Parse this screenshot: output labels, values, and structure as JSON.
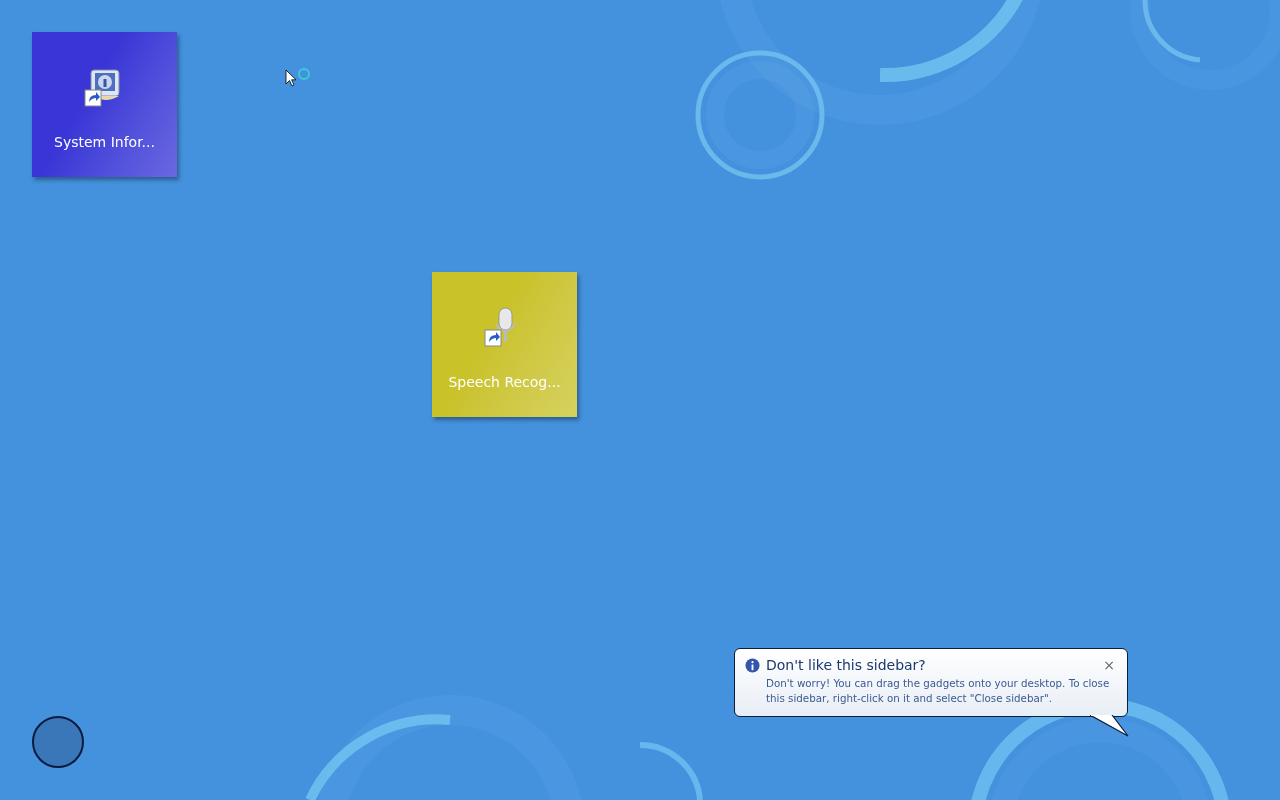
{
  "tiles": [
    {
      "label": "System Infor...",
      "color": "#3a35d6",
      "kind": "info",
      "selected": false
    },
    {
      "label": "Speech Recog...",
      "color": "#c9c229",
      "kind": "mic",
      "selected": false
    }
  ],
  "balloon": {
    "title": "Don't like this sidebar?",
    "text": "Don't worry! You can drag the gadgets onto your desktop. To close this sidebar, right-click on it and select \"Close sidebar\".",
    "close": "×"
  }
}
